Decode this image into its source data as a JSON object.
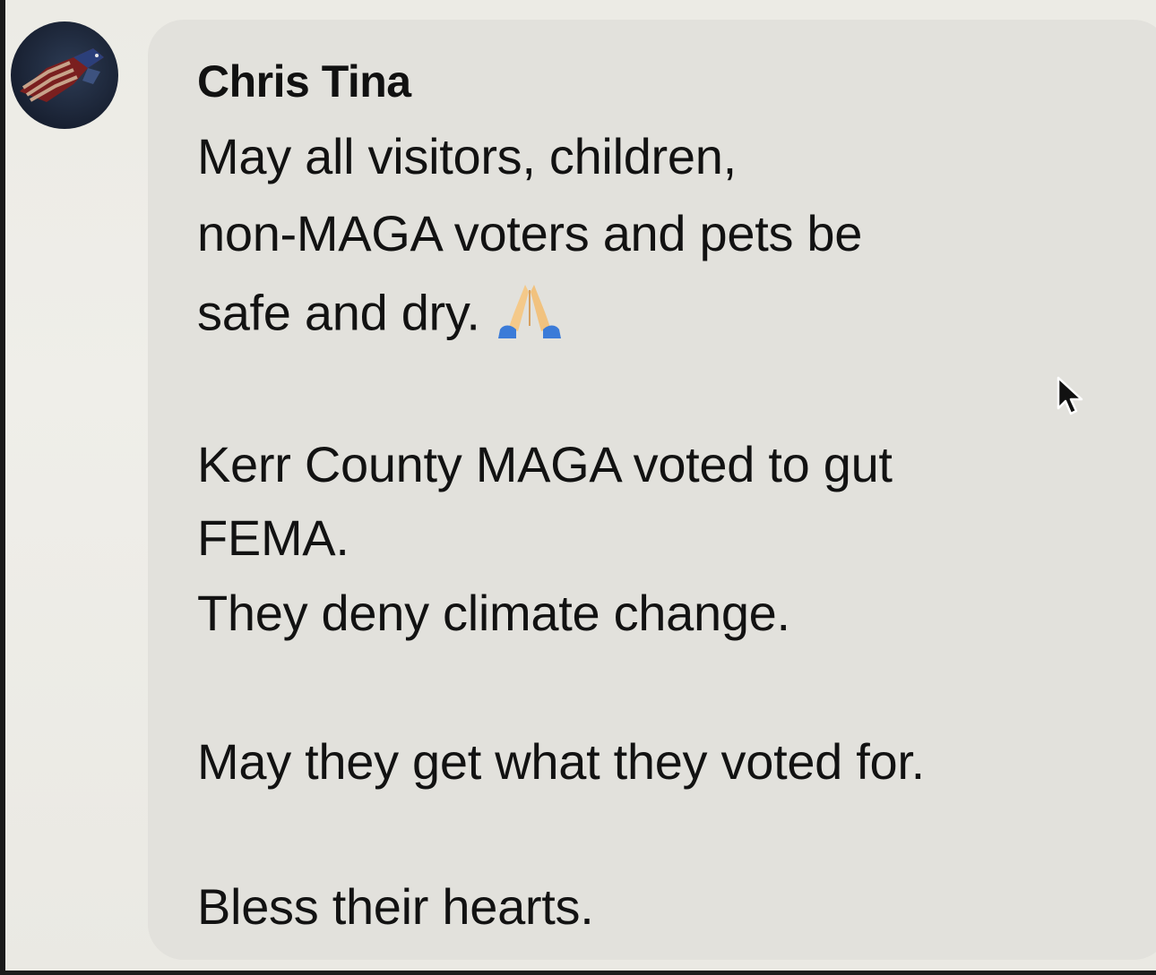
{
  "comment": {
    "author": "Chris Tina",
    "lines": [
      "May all visitors, children,",
      "non-MAGA voters and pets be",
      "safe and dry.",
      "Kerr County MAGA voted to gut",
      "FEMA.",
      "They deny climate change.",
      "May they get what they voted for.",
      "Bless their hearts."
    ],
    "emoji": "folded-hands-icon"
  },
  "icons": {
    "avatar": "eagle-flag-avatar",
    "cursor": "mouse-pointer-icon"
  },
  "colors": {
    "bubble": "#e2e1dc",
    "text": "#121212"
  }
}
